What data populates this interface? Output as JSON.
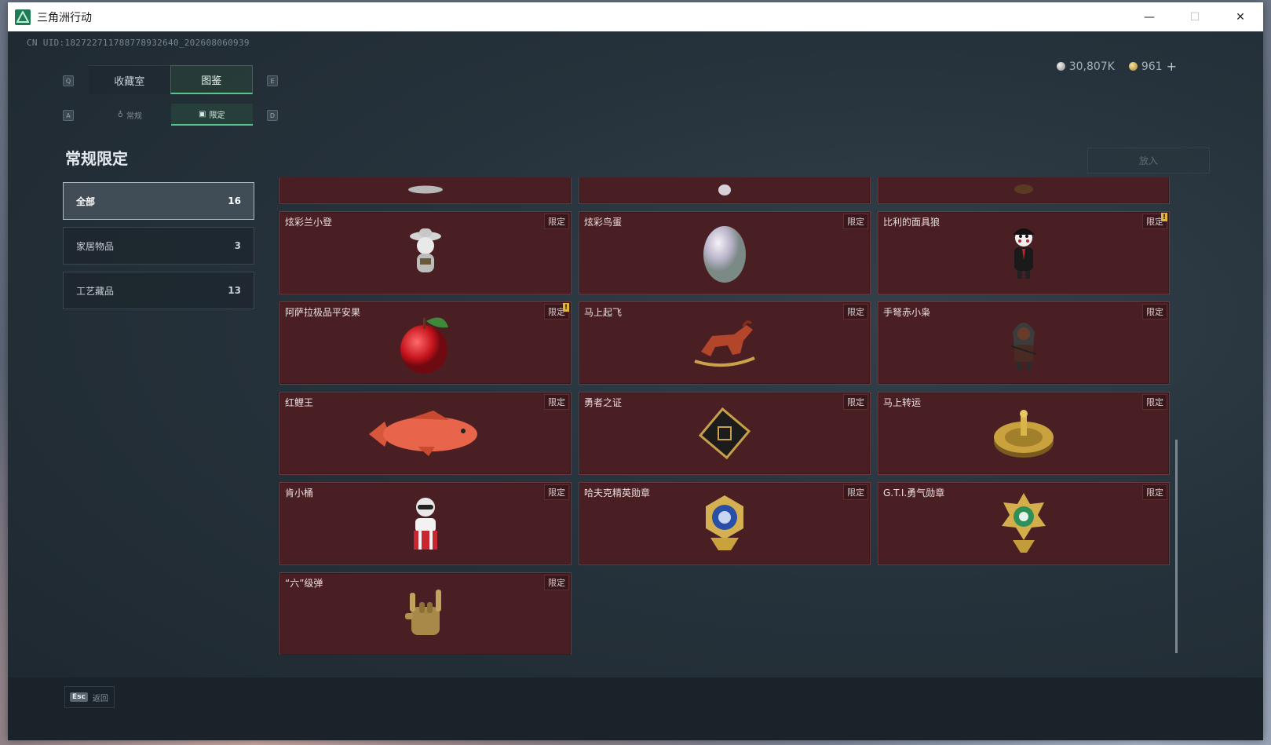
{
  "window": {
    "title": "三角洲行动",
    "controls": {
      "minimize": "—",
      "maximize": "☐",
      "close": "✕"
    }
  },
  "uid": "CN UID:1827227117887789326​40_202608060939",
  "tabs_main": [
    {
      "label": "收藏室",
      "active": false
    },
    {
      "label": "图鉴",
      "active": true
    }
  ],
  "tabs_sub": [
    {
      "label": "常规",
      "active": false
    },
    {
      "label": "限定",
      "active": true
    }
  ],
  "key_hints": {
    "q": "Q",
    "e": "E",
    "a": "A",
    "d": "D"
  },
  "currency": {
    "silver": "30,807K",
    "gold": "961",
    "plus": "+"
  },
  "section_title": "常规限定",
  "place_button": "放入",
  "categories": [
    {
      "label": "全部",
      "count": "16",
      "active": true
    },
    {
      "label": "家居物品",
      "count": "3",
      "active": false
    },
    {
      "label": "工艺藏品",
      "count": "13",
      "active": false
    }
  ],
  "badge_label": "限定",
  "items": [
    {
      "name": "炫彩兰小登",
      "icon": "figurine-hat-icon",
      "warn": false
    },
    {
      "name": "炫彩鸟蛋",
      "icon": "egg-icon",
      "warn": false
    },
    {
      "name": "比利的面具狼",
      "icon": "puppet-icon",
      "warn": true
    },
    {
      "name": "阿萨拉极品平安果",
      "icon": "apple-icon",
      "warn": true
    },
    {
      "name": "马上起飞",
      "icon": "rocking-horse-icon",
      "warn": false
    },
    {
      "name": "手弩赤小枭",
      "icon": "hooded-figure-icon",
      "warn": false
    },
    {
      "name": "红鲤王",
      "icon": "carp-icon",
      "warn": false
    },
    {
      "name": "勇者之证",
      "icon": "card-icon",
      "warn": false
    },
    {
      "name": "马上转运",
      "icon": "roulette-icon",
      "warn": false
    },
    {
      "name": "肯小桶",
      "icon": "bucket-figure-icon",
      "warn": false
    },
    {
      "name": "哈夫克精英勋章",
      "icon": "blue-medal-icon",
      "warn": false
    },
    {
      "name": "G.T.I.勇气勋章",
      "icon": "green-medal-icon",
      "warn": false
    },
    {
      "name": "“六”级弹",
      "icon": "glove-icon",
      "warn": false
    }
  ],
  "footer": {
    "esc_key": "Esc",
    "esc_label": "返回"
  },
  "colors": {
    "accent": "#56c48e",
    "card_bg": "#4a1f24",
    "card_border": "#6b3940"
  }
}
